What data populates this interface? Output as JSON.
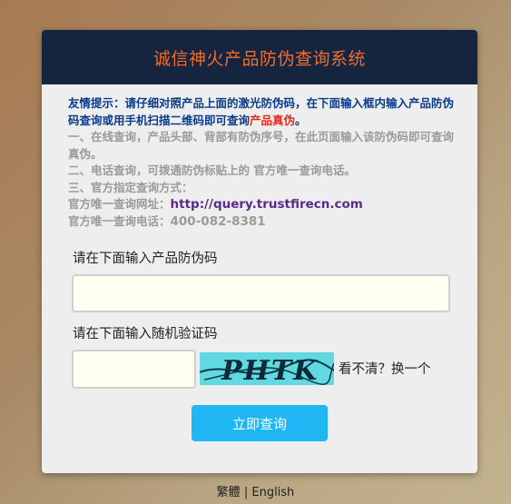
{
  "header": {
    "title": "诚信神火产品防伪查询系统"
  },
  "notice": {
    "tip_prefix": "友情提示：请仔细对照产品上面的激光防伪码，在下面输入框内输入产品防伪码查询或用手机扫描二维码即可查询",
    "tip_highlight": "产品真伪",
    "tip_suffix": "。",
    "line1": "一、在线查询，产品头部、背部有防伪序号，在此页面输入该防伪码即可查询真伪。",
    "line2": "二、电话查询，可拨通防伪标贴上的 官方唯一查询电话。",
    "line3": "三、官方指定查询方式：",
    "website_label": "官方唯一查询网址：",
    "website_url": "http://query.trustfirecn.com",
    "phone_label": "官方唯一查询电话：",
    "phone_number": "400-082-8381"
  },
  "form": {
    "code_label": "请在下面输入产品防伪码",
    "code_value": "",
    "captcha_label": "请在下面输入随机验证码",
    "captcha_value": "",
    "captcha_text": "PHTK",
    "refresh_text": "看不清？换一个",
    "submit_label": "立即查询"
  },
  "footer": {
    "lang_traditional": "繁體",
    "separator": "|",
    "lang_english": "English"
  },
  "colors": {
    "header_bg": "#15243f",
    "title": "#f06d2c",
    "submit": "#1fb6f4",
    "captcha_bg": "#62d8e0"
  }
}
